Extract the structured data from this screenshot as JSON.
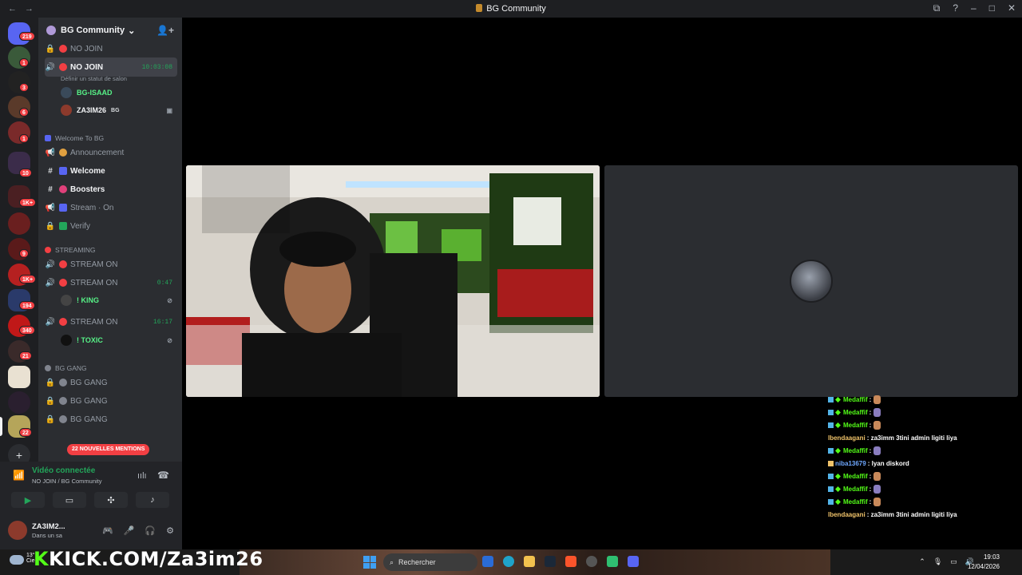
{
  "window": {
    "title": "BG Community"
  },
  "guilds": {
    "badges": [
      "219",
      "1",
      "3",
      "6",
      "1",
      "10",
      "1K+",
      "9",
      "1K+",
      "194",
      "340",
      "21",
      "22"
    ]
  },
  "server": {
    "name": "BG Community",
    "channels_top": [
      {
        "name": "NO JOIN"
      },
      {
        "name": "NO JOIN",
        "time": "10:03:08",
        "status": "Définir un statut de salon"
      }
    ],
    "voice_users_top": [
      {
        "name": "BG-ISAAD",
        "color": "#57f287"
      },
      {
        "name": "ZA3IM26",
        "tag": "BG",
        "color": "#f2f3f5"
      }
    ],
    "category_welcome": "Welcome To BG",
    "welcome_channels": [
      {
        "name": "Announcement"
      },
      {
        "name": "Welcome"
      },
      {
        "name": "Boosters"
      },
      {
        "name": "Stream · On"
      },
      {
        "name": "Verify"
      }
    ],
    "category_streaming": "STREAMING",
    "streaming": [
      {
        "name": "STREAM ON"
      },
      {
        "name": "STREAM ON",
        "time": "0:47"
      },
      {
        "name": "STREAM ON",
        "time": "16:17"
      }
    ],
    "stream_users": [
      {
        "name": "! KING",
        "color": "#57f287"
      },
      {
        "name": "! TOXIC",
        "color": "#57f287"
      }
    ],
    "category_gang": "BG GANG",
    "gang": [
      {
        "name": "BG GANG"
      },
      {
        "name": "BG GANG"
      },
      {
        "name": "BG GANG"
      }
    ],
    "mention_banner": "22 NOUVELLES MENTIONS"
  },
  "voice_panel": {
    "status": "Vidéo connectée",
    "sub": "NO JOIN / BG Community"
  },
  "user_bar": {
    "name": "ZA3IM2...",
    "status": "Dans un sa"
  },
  "chat": [
    {
      "name": "Medaffif",
      "color": "#53fc18",
      "msg": "",
      "emote": "#c9895a"
    },
    {
      "name": "Medaffif",
      "color": "#53fc18",
      "msg": "",
      "emote": "#8a7dbf"
    },
    {
      "name": "Medaffif",
      "color": "#53fc18",
      "msg": "",
      "emote": "#c9895a"
    },
    {
      "name": "lbendaagani",
      "color": "#f0c36a",
      "msg": "za3imm 3tini admin ligiti liya",
      "emote": ""
    },
    {
      "name": "Medaffif",
      "color": "#53fc18",
      "msg": "",
      "emote": "#8a7dbf"
    },
    {
      "name": "niba13679",
      "color": "#6fa8ff",
      "msg": "lyan diskord",
      "emote": ""
    },
    {
      "name": "Medaffif",
      "color": "#53fc18",
      "msg": "",
      "emote": "#c9895a"
    },
    {
      "name": "Medaffif",
      "color": "#53fc18",
      "msg": "",
      "emote": "#8a7dbf"
    },
    {
      "name": "Medaffif",
      "color": "#53fc18",
      "msg": "",
      "emote": "#c9895a"
    },
    {
      "name": "lbendaagani",
      "color": "#f0c36a",
      "msg": "za3imm 3tini admin ligiti liya",
      "emote": ""
    }
  ],
  "overlay": {
    "kick_k": "K",
    "kick_text": "KICK.COM/Za3im26"
  },
  "taskbar": {
    "search_placeholder": "Rechercher",
    "time": "19:03",
    "date": "12/04/2026",
    "weather": "13°",
    "weather_sub": "Cie"
  }
}
